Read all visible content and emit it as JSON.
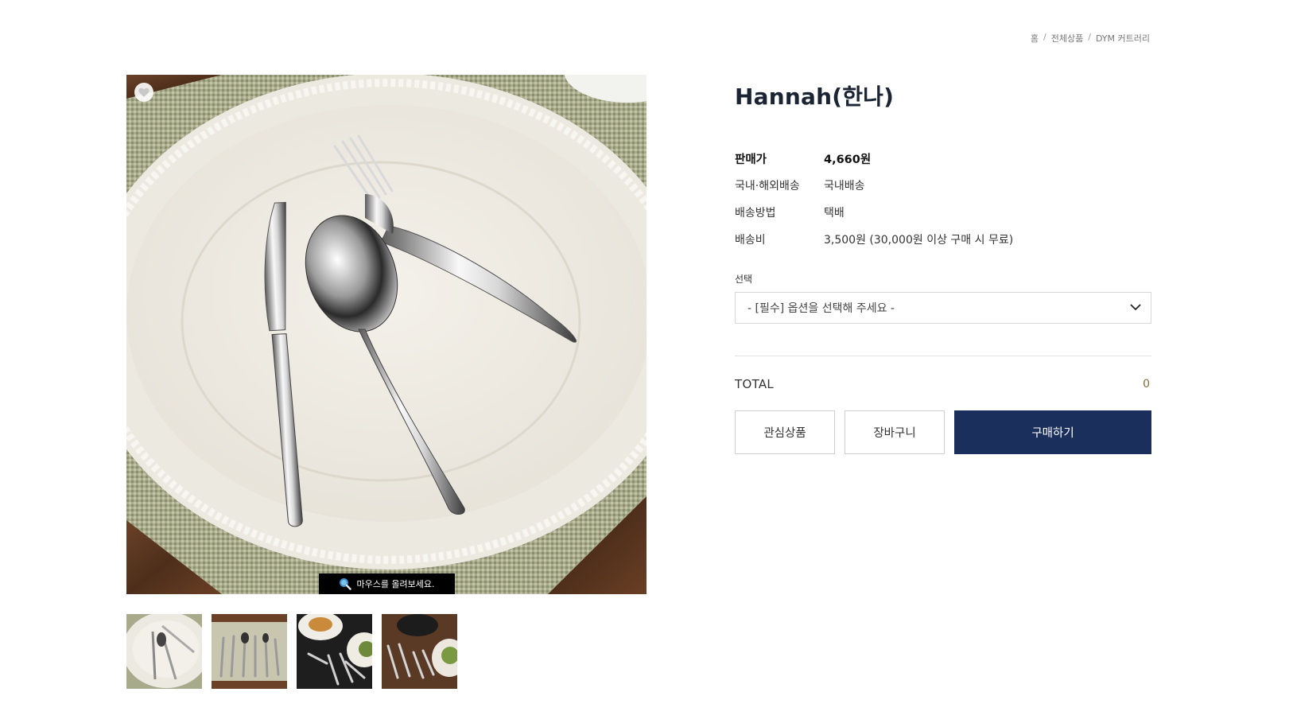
{
  "breadcrumb": [
    {
      "label": "홈"
    },
    {
      "label": "전체상품"
    },
    {
      "label": "DYM 커트러리"
    }
  ],
  "breadcrumb_separator": "/",
  "product": {
    "title": "Hannah(한나)",
    "zoom_hint": "마우스를 올려보세요.",
    "specs": {
      "price_label": "판매가",
      "price_value": "4,660원",
      "shipping_scope_label": "국내·해외배송",
      "shipping_scope_value": "국내배송",
      "shipping_method_label": "배송방법",
      "shipping_method_value": "택배",
      "shipping_fee_label": "배송비",
      "shipping_fee_value": "3,500원 (30,000원 이상 구매 시 무료)"
    },
    "option": {
      "label": "선택",
      "selected": "- [필수] 옵션을 선택해 주세요 -"
    },
    "total": {
      "label": "TOTAL",
      "value": "0"
    },
    "buttons": {
      "wishlist": "관심상품",
      "cart": "장바구니",
      "buy": "구매하기"
    }
  },
  "thumbnails": [
    {
      "icon": "thumb-plate-cutlery"
    },
    {
      "icon": "thumb-cutlery-set-mat"
    },
    {
      "icon": "thumb-pasta-dark-table"
    },
    {
      "icon": "thumb-salad-dark-table"
    }
  ],
  "colors": {
    "primary_button": "#1b2f5c",
    "title": "#1b2433",
    "total_value": "#8a6d3b"
  }
}
